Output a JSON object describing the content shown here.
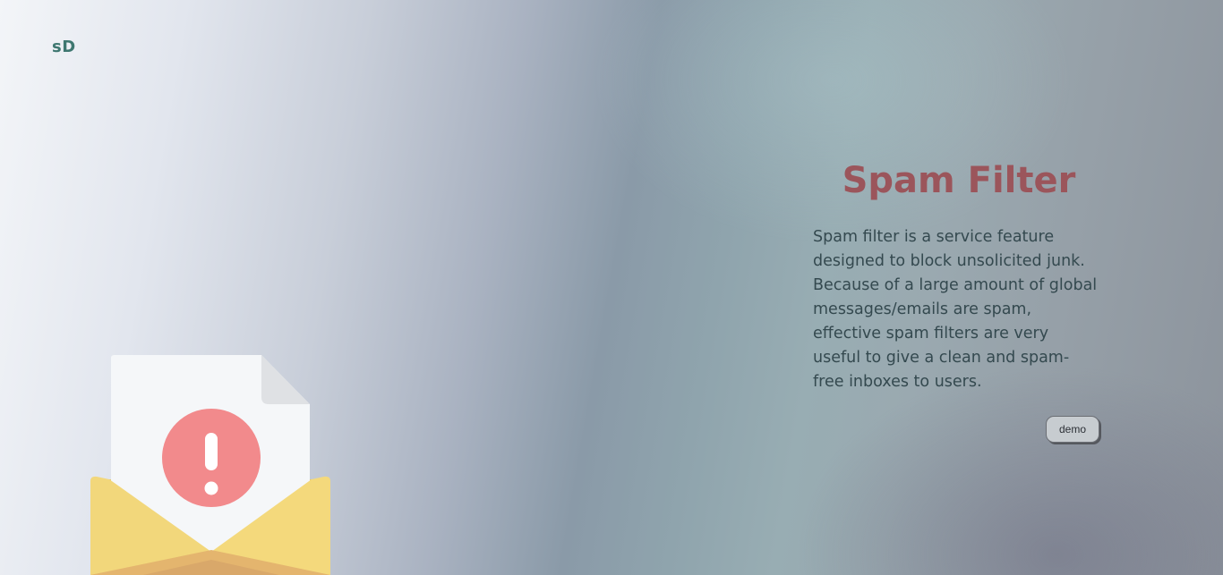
{
  "header": {
    "logo_text": "sD"
  },
  "hero": {
    "title": "Spam Filter",
    "description": "Spam filter is a service feature designed to block unsolicited junk. Because of a large amount of global messages/emails are spam, effective spam filters are very useful to give a clean and spam-free inboxes to users.",
    "demo_button_label": "demo",
    "illustration_icon": "envelope-alert-icon"
  },
  "colors": {
    "title": "#9b555b",
    "logo": "#3e7770",
    "alert_red": "#f08a8c",
    "envelope_yellow": "#f3d77a"
  }
}
